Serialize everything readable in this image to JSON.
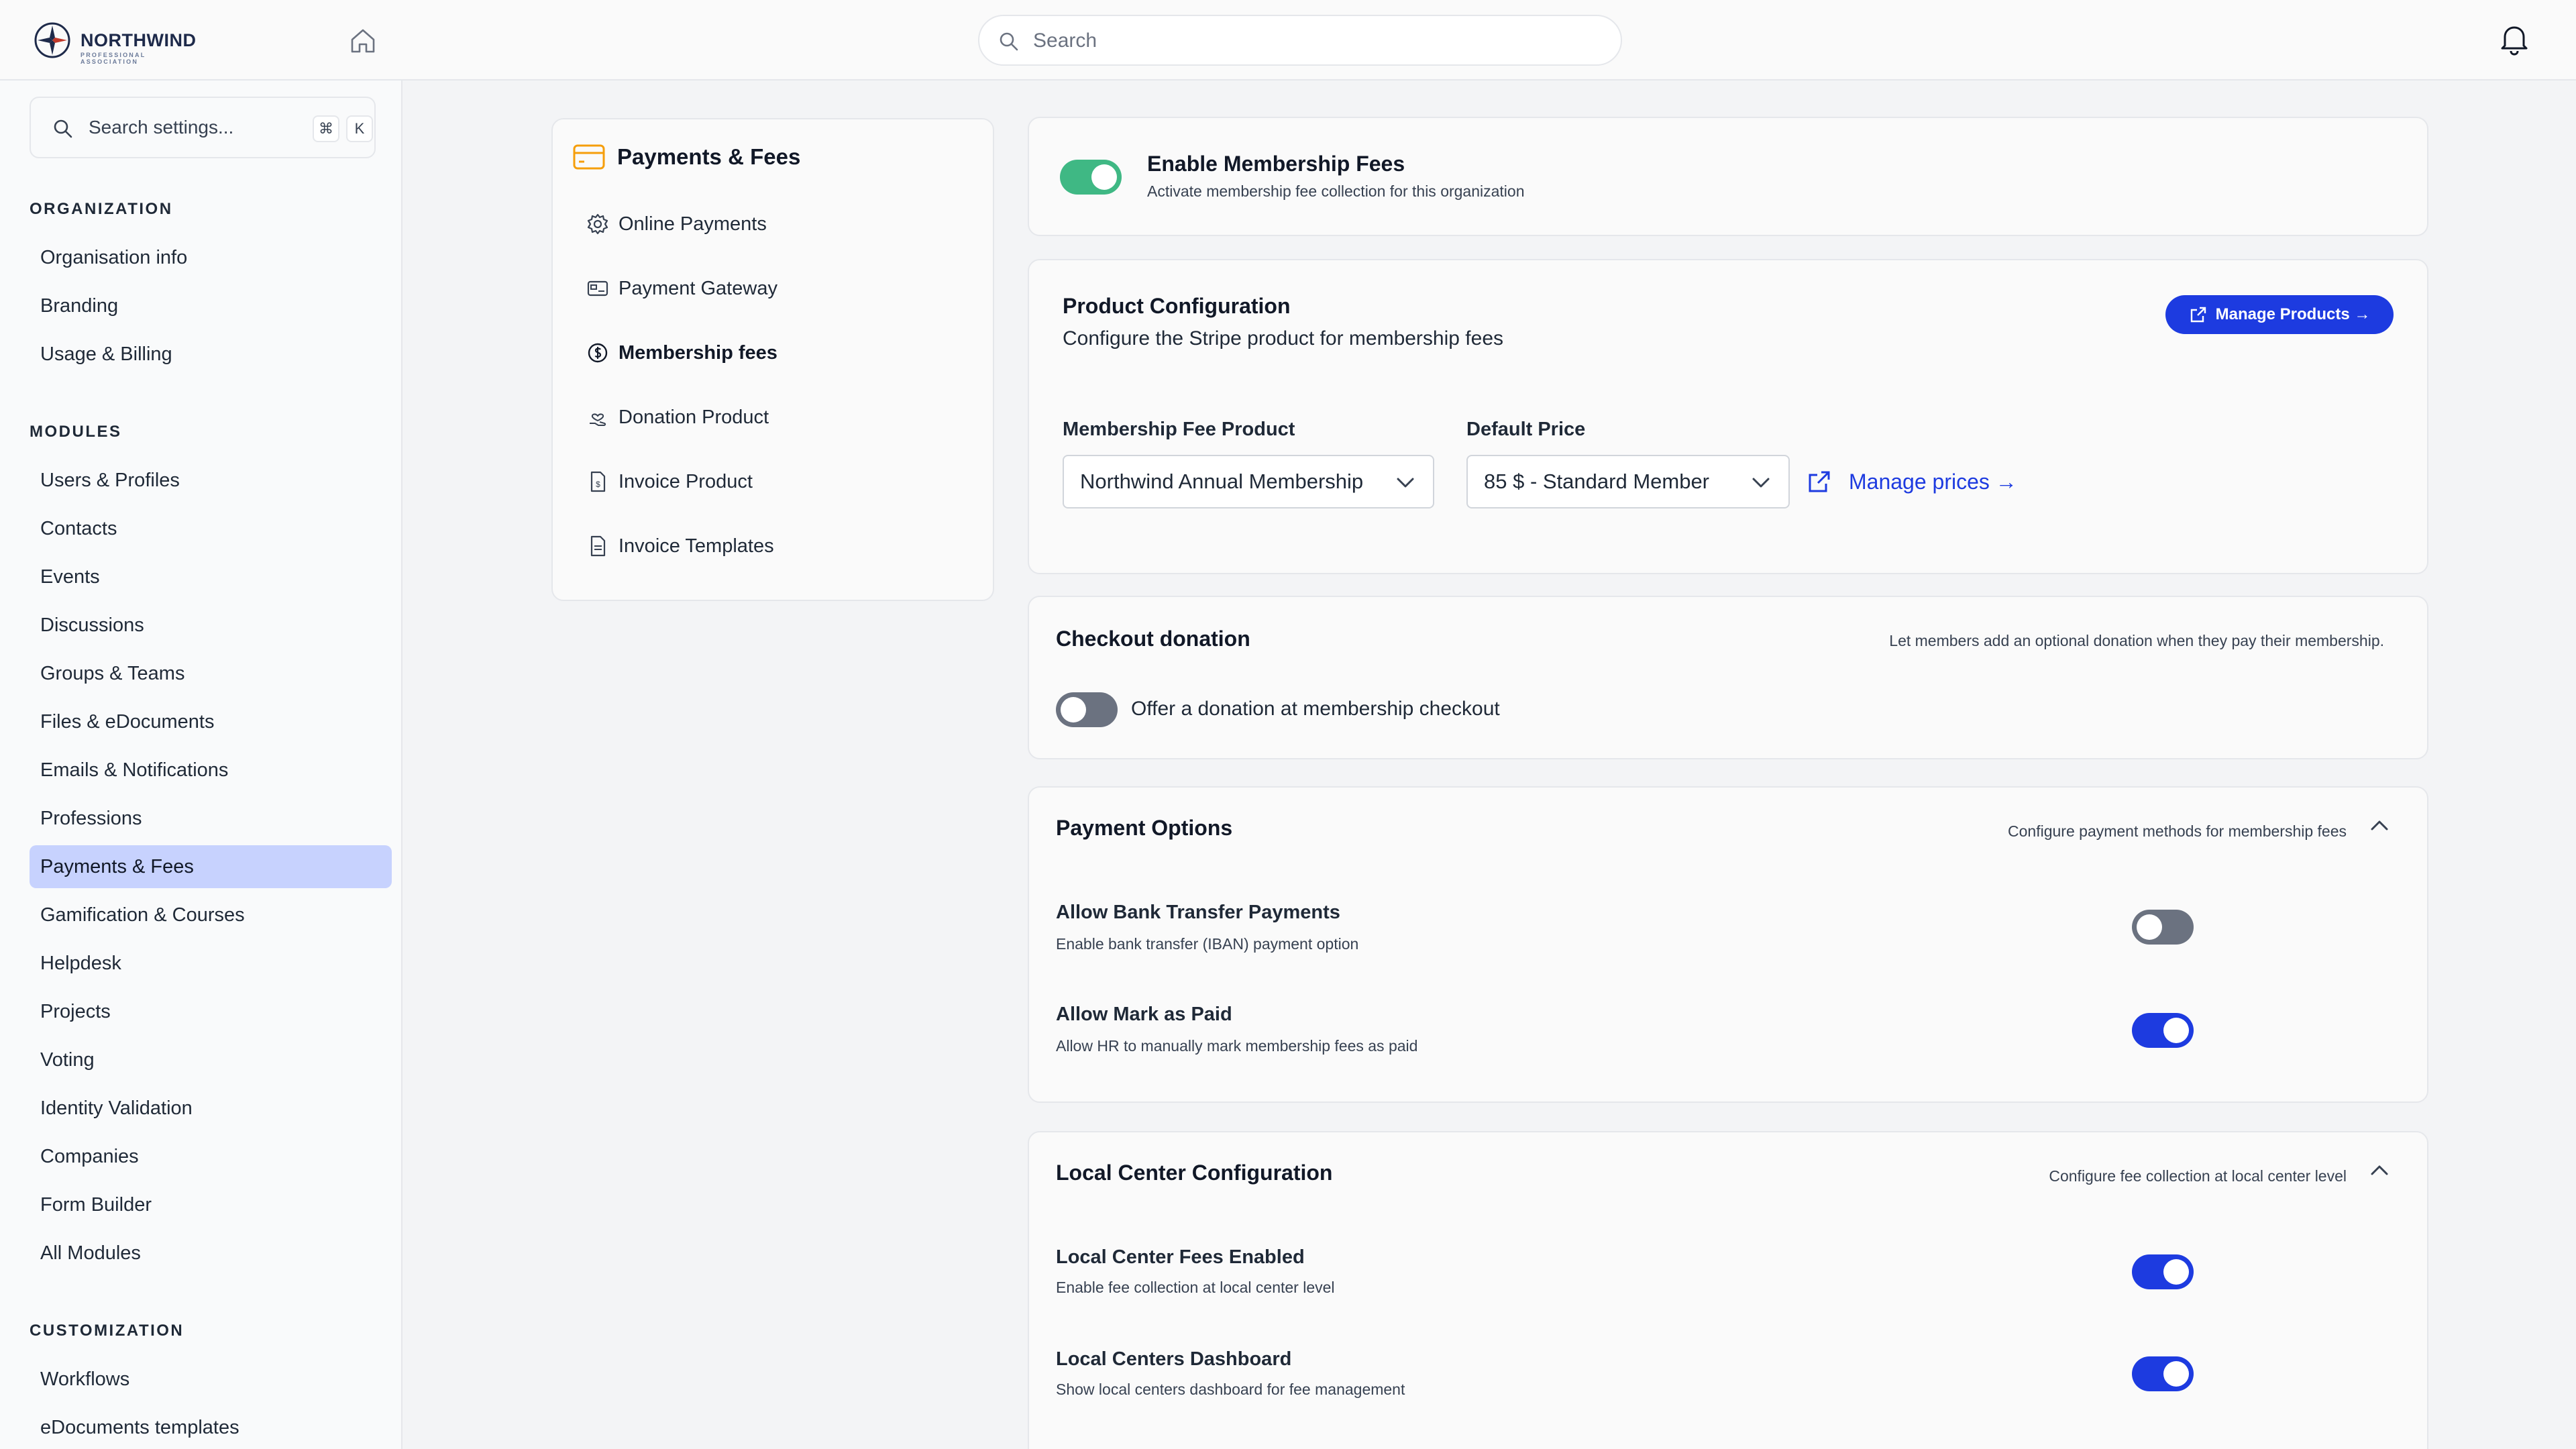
{
  "app": {
    "logo_name": "NORTHWIND",
    "logo_sub": "PROFESSIONAL ASSOCIATION",
    "search_placeholder": "Search"
  },
  "sidebar": {
    "search_placeholder": "Search settings...",
    "shortcut_keys": [
      "⌘",
      "K"
    ],
    "sections": [
      {
        "title": "ORGANIZATION",
        "items": [
          "Organisation info",
          "Branding",
          "Usage & Billing"
        ]
      },
      {
        "title": "MODULES",
        "items": [
          "Users & Profiles",
          "Contacts",
          "Events",
          "Discussions",
          "Groups & Teams",
          "Files & eDocuments",
          "Emails & Notifications",
          "Professions",
          "Payments & Fees",
          "Gamification & Courses",
          "Helpdesk",
          "Projects",
          "Voting",
          "Identity Validation",
          "Companies",
          "Form Builder",
          "All Modules"
        ]
      },
      {
        "title": "CUSTOMIZATION",
        "items": [
          "Workflows",
          "eDocuments templates"
        ]
      }
    ],
    "active_item": "Payments & Fees"
  },
  "subnav": {
    "title": "Payments & Fees",
    "items": [
      {
        "label": "Online Payments",
        "icon": "gear-icon"
      },
      {
        "label": "Payment Gateway",
        "icon": "gateway-icon"
      },
      {
        "label": "Membership fees",
        "icon": "dollar-circle-icon"
      },
      {
        "label": "Donation Product",
        "icon": "donation-hand-icon"
      },
      {
        "label": "Invoice Product",
        "icon": "invoice-icon"
      },
      {
        "label": "Invoice Templates",
        "icon": "document-icon"
      }
    ],
    "active_item": "Membership fees"
  },
  "membership": {
    "title": "Enable Membership Fees",
    "description": "Activate membership fee collection for this organization",
    "enabled": true
  },
  "product_config": {
    "title": "Product Configuration",
    "description": "Configure the Stripe product for membership fees",
    "manage_button": "Manage Products →",
    "product_label": "Membership Fee Product",
    "product_value": "Northwind Annual Membership",
    "price_label": "Default Price",
    "price_value": "85 $ - Standard Member",
    "manage_prices_link": "Manage prices →"
  },
  "checkout_donation": {
    "title": "Checkout donation",
    "note": "Let members add an optional donation when they pay their membership.",
    "toggle_label": "Offer a donation at membership checkout",
    "enabled": false
  },
  "payment_options": {
    "title": "Payment Options",
    "note": "Configure payment methods for membership fees",
    "options": [
      {
        "title": "Allow Bank Transfer Payments",
        "description": "Enable bank transfer (IBAN) payment option",
        "enabled": false
      },
      {
        "title": "Allow Mark as Paid",
        "description": "Allow HR to manually mark membership fees as paid",
        "enabled": true
      }
    ]
  },
  "local_center": {
    "title": "Local Center Configuration",
    "note": "Configure fee collection at local center level",
    "options": [
      {
        "title": "Local Center Fees Enabled",
        "description": "Enable fee collection at local center level",
        "enabled": true
      },
      {
        "title": "Local Centers Dashboard",
        "description": "Show local centers dashboard for fee management",
        "enabled": true
      }
    ]
  },
  "colors": {
    "accent_blue": "#1d3be0",
    "toggle_green": "#3fb884",
    "active_nav_bg": "#c7d2fe",
    "toggle_off": "#6b7280",
    "icon_orange": "#f59e0b"
  }
}
